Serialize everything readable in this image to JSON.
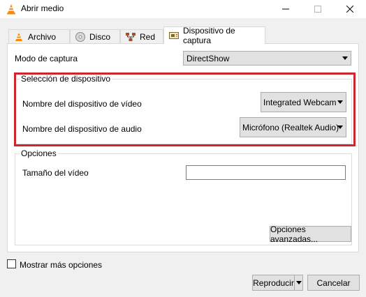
{
  "window": {
    "title": "Abrir medio"
  },
  "tabs": [
    {
      "label": "Archivo",
      "icon": "file-icon"
    },
    {
      "label": "Disco",
      "icon": "disc-icon"
    },
    {
      "label": "Red",
      "icon": "network-icon"
    },
    {
      "label": "Dispositivo de captura",
      "icon": "capture-device-icon",
      "active": true
    }
  ],
  "capture": {
    "mode_label": "Modo de captura",
    "mode_value": "DirectShow"
  },
  "device_selection": {
    "title": "Selección de dispositivo",
    "video_label": "Nombre del dispositivo de vídeo",
    "video_value": "Integrated Webcam",
    "audio_label": "Nombre del dispositivo de audio",
    "audio_value": "Micrófono (Realtek Audio)"
  },
  "options": {
    "title": "Opciones",
    "video_size_label": "Tamaño del vídeo",
    "video_size_value": "",
    "advanced_button": "Opciones avanzadas..."
  },
  "footer": {
    "more_options_label": "Mostrar más opciones",
    "play_button": "Reproducir",
    "cancel_button": "Cancelar"
  },
  "colors": {
    "highlight": "#d1242f",
    "vlc_orange": "#f58a0b"
  }
}
